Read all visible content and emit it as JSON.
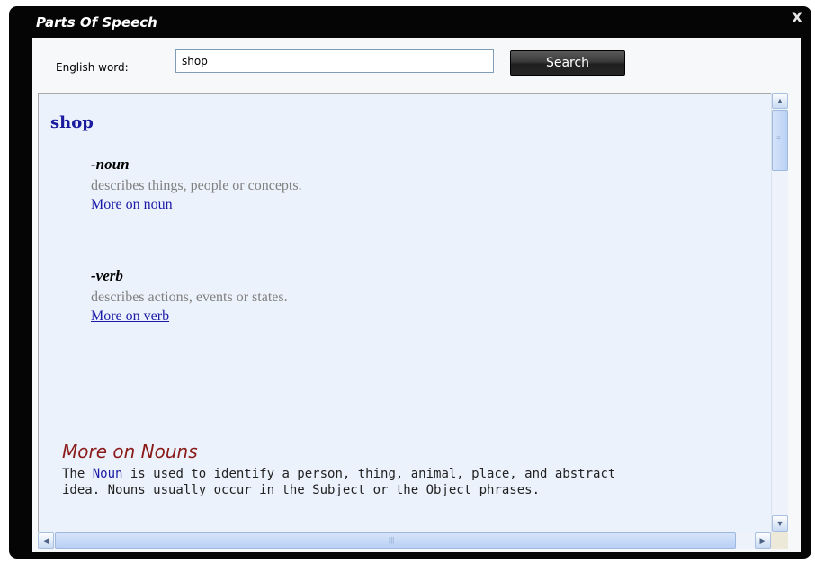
{
  "window": {
    "title": "Parts Of Speech",
    "close_label": "X"
  },
  "search": {
    "label": "English word:",
    "value": "shop",
    "button_label": "Search"
  },
  "result": {
    "word": "shop",
    "parts": [
      {
        "label": "-noun",
        "description": "describes things, people or concepts.",
        "link": "More on noun"
      },
      {
        "label": "-verb",
        "description": "describes actions, events or states.",
        "link": "More on verb"
      }
    ],
    "more": {
      "heading": "More on Nouns",
      "text_before": "The ",
      "keyword": "Noun",
      "text_line1_after": " is used to identify a person, thing, animal, place, and abstract",
      "text_line2": "idea. Nouns usually occur in the Subject or the Object phrases."
    }
  },
  "scrollbars": {
    "up_icon": "▲",
    "down_icon": "▼",
    "left_icon": "◀",
    "right_icon": "▶"
  },
  "colors": {
    "window_frame": "#050505",
    "content_bg": "#ecf2fb",
    "word": "#1b1b9f",
    "link": "#1a1aa6",
    "more_heading": "#8b1a1a"
  }
}
